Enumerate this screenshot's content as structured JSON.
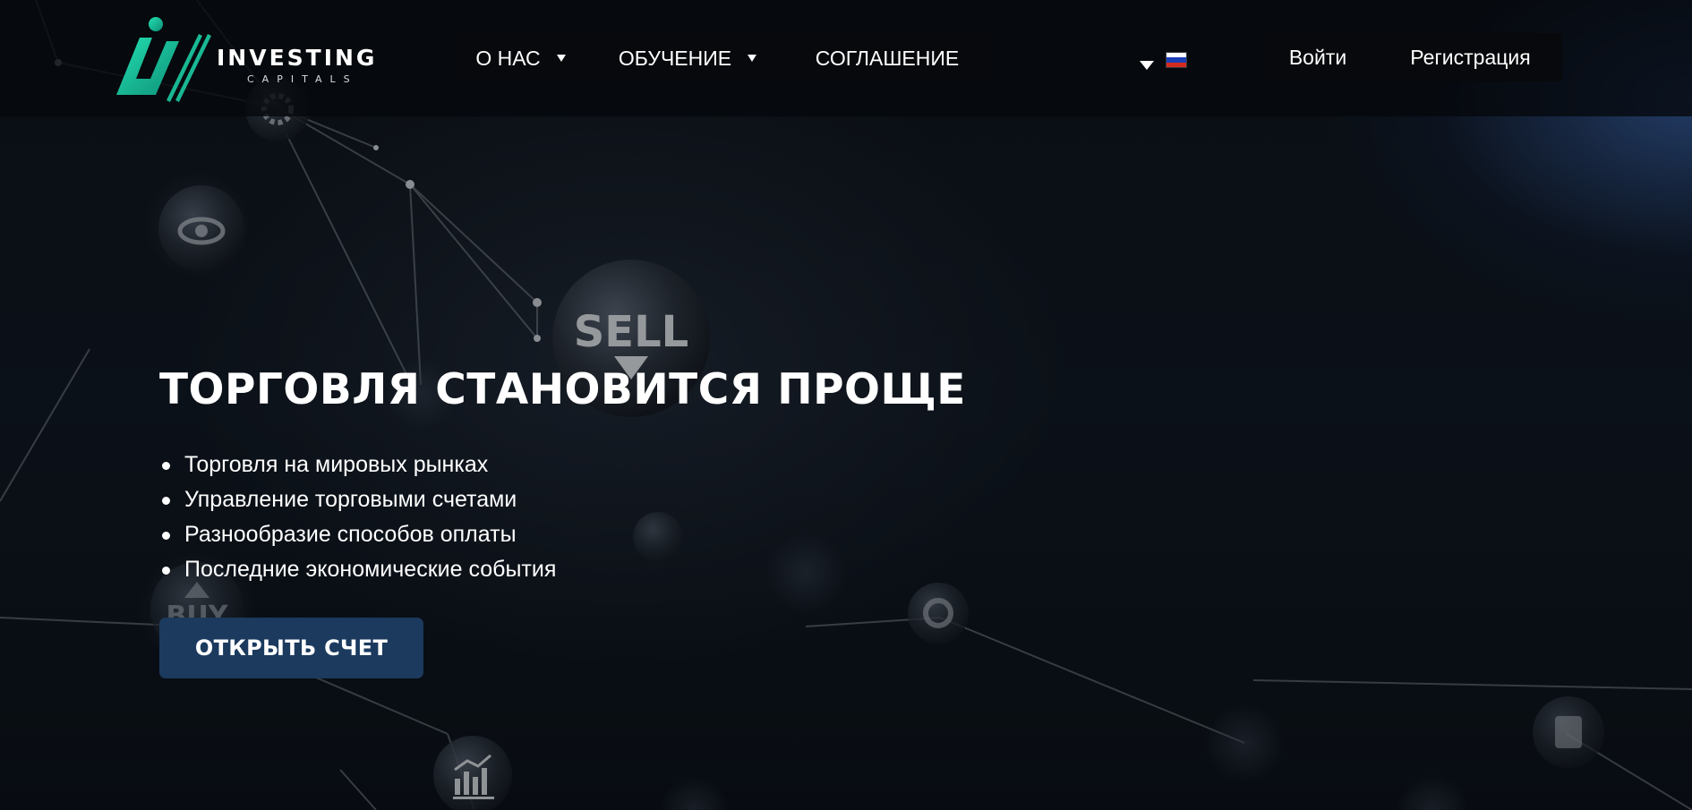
{
  "brand": {
    "name": "INVESTING",
    "tagline": "CAPITALS",
    "accent_color": "#12c9a0"
  },
  "nav": {
    "items": [
      {
        "label": "О НАС",
        "has_dropdown": true
      },
      {
        "label": "ОБУЧЕНИЕ",
        "has_dropdown": true
      },
      {
        "label": "СОГЛАШЕНИЕ",
        "has_dropdown": false
      }
    ]
  },
  "language": {
    "icon": "russian-flag-icon",
    "dropdown_icon": "caret-down-icon"
  },
  "auth": {
    "login_label": "Войти",
    "register_label": "Регистрация"
  },
  "hero": {
    "title": "ТОРГОВЛЯ СТАНОВИТСЯ ПРОЩЕ",
    "features": [
      "Торговля на мировых рынках",
      "Управление торговыми счетами",
      "Разнообразие способов оплаты",
      "Последние экономические события"
    ],
    "cta_label": "ОТКРЫТЬ СЧЕТ",
    "cta_color": "#1b3a5e"
  },
  "background": {
    "sell_label": "SELL",
    "buy_label": "BUY"
  }
}
